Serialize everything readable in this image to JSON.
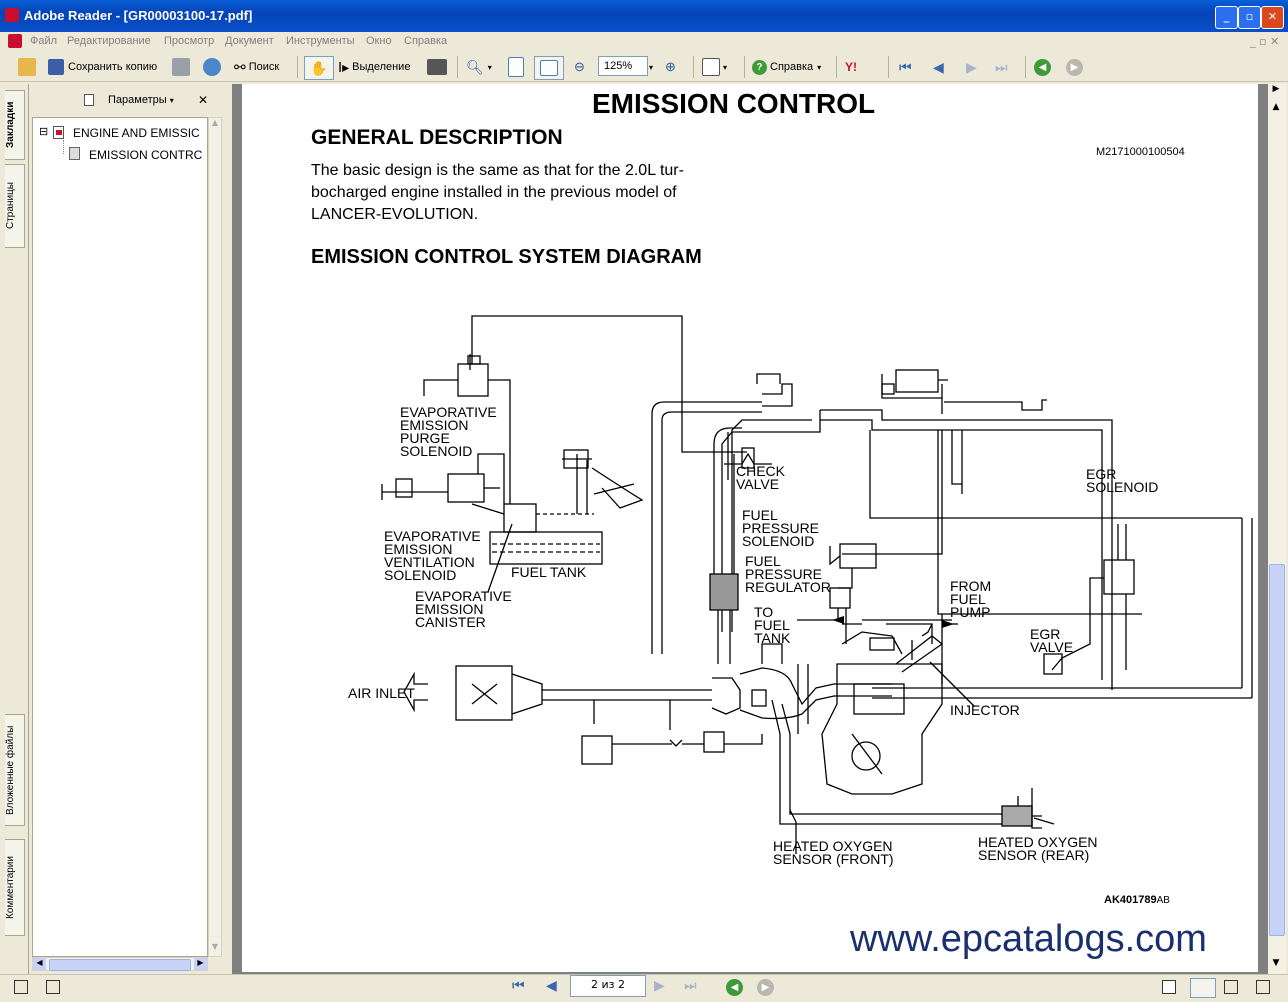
{
  "window": {
    "title": "Adobe Reader - [GR00003100-17.pdf]",
    "min_glyph": "_",
    "max_glyph": "▫",
    "close_glyph": "✕"
  },
  "menu": [
    "Файл",
    "Редактирование",
    "Просмотр",
    "Документ",
    "Инструменты",
    "Окно",
    "Справка"
  ],
  "toolbar": {
    "save_copy": "Сохранить копию",
    "search": "Поиск",
    "select": "Выделение",
    "zoom_value": "125%",
    "help": "Справка"
  },
  "nav": {
    "tabs": [
      "Закладки",
      "Страницы",
      "Вложенные файлы",
      "Комментарии"
    ],
    "options_label": "Параметры",
    "close_glyph": "✕",
    "bookmarks": [
      {
        "label": "ENGINE AND EMISSIC",
        "expander": "⊟"
      },
      {
        "label": "EMISSION CONTRC"
      }
    ]
  },
  "document": {
    "title": "EMISSION CONTROL",
    "section_heading": "GENERAL DESCRIPTION",
    "doc_code": "M2171000100504",
    "body_lines": [
      "The basic design is the same as that  for the 2.0L tur-",
      "bocharged engine installed in the previous model of",
      "LANCER-EVOLUTION."
    ],
    "diagram_heading": "EMISSION CONTROL SYSTEM DIAGRAM",
    "figure_id": "AK401789",
    "figure_suffix": "AB",
    "watermark": "www.epcatalogs.com",
    "labels": {
      "purge": "EVAPORATIVE\nEMISSION\nPURGE\nSOLENOID",
      "ventilation": "EVAPORATIVE\nEMISSION\nVENTILATION\nSOLENOID",
      "fuel_tank": "FUEL TANK",
      "canister": "EVAPORATIVE\nEMISSION\nCANISTER",
      "check_valve": "CHECK\nVALVE",
      "fuel_pressure_solenoid": "FUEL\nPRESSURE\nSOLENOID",
      "fuel_pressure_regulator": "FUEL\nPRESSURE\nREGULATOR",
      "to_fuel_tank": "TO\nFUEL\nTANK",
      "from_fuel_pump": "FROM\nFUEL\nPUMP",
      "egr_solenoid": "EGR\nSOLENOID",
      "egr_valve": "EGR\nVALVE",
      "air_inlet": "AIR INLET",
      "injector": "INJECTOR",
      "hos_front": "HEATED OXYGEN\nSENSOR (FRONT)",
      "hos_rear": "HEATED OXYGEN\nSENSOR (REAR)"
    }
  },
  "status": {
    "page_indicator": "2 из 2"
  }
}
